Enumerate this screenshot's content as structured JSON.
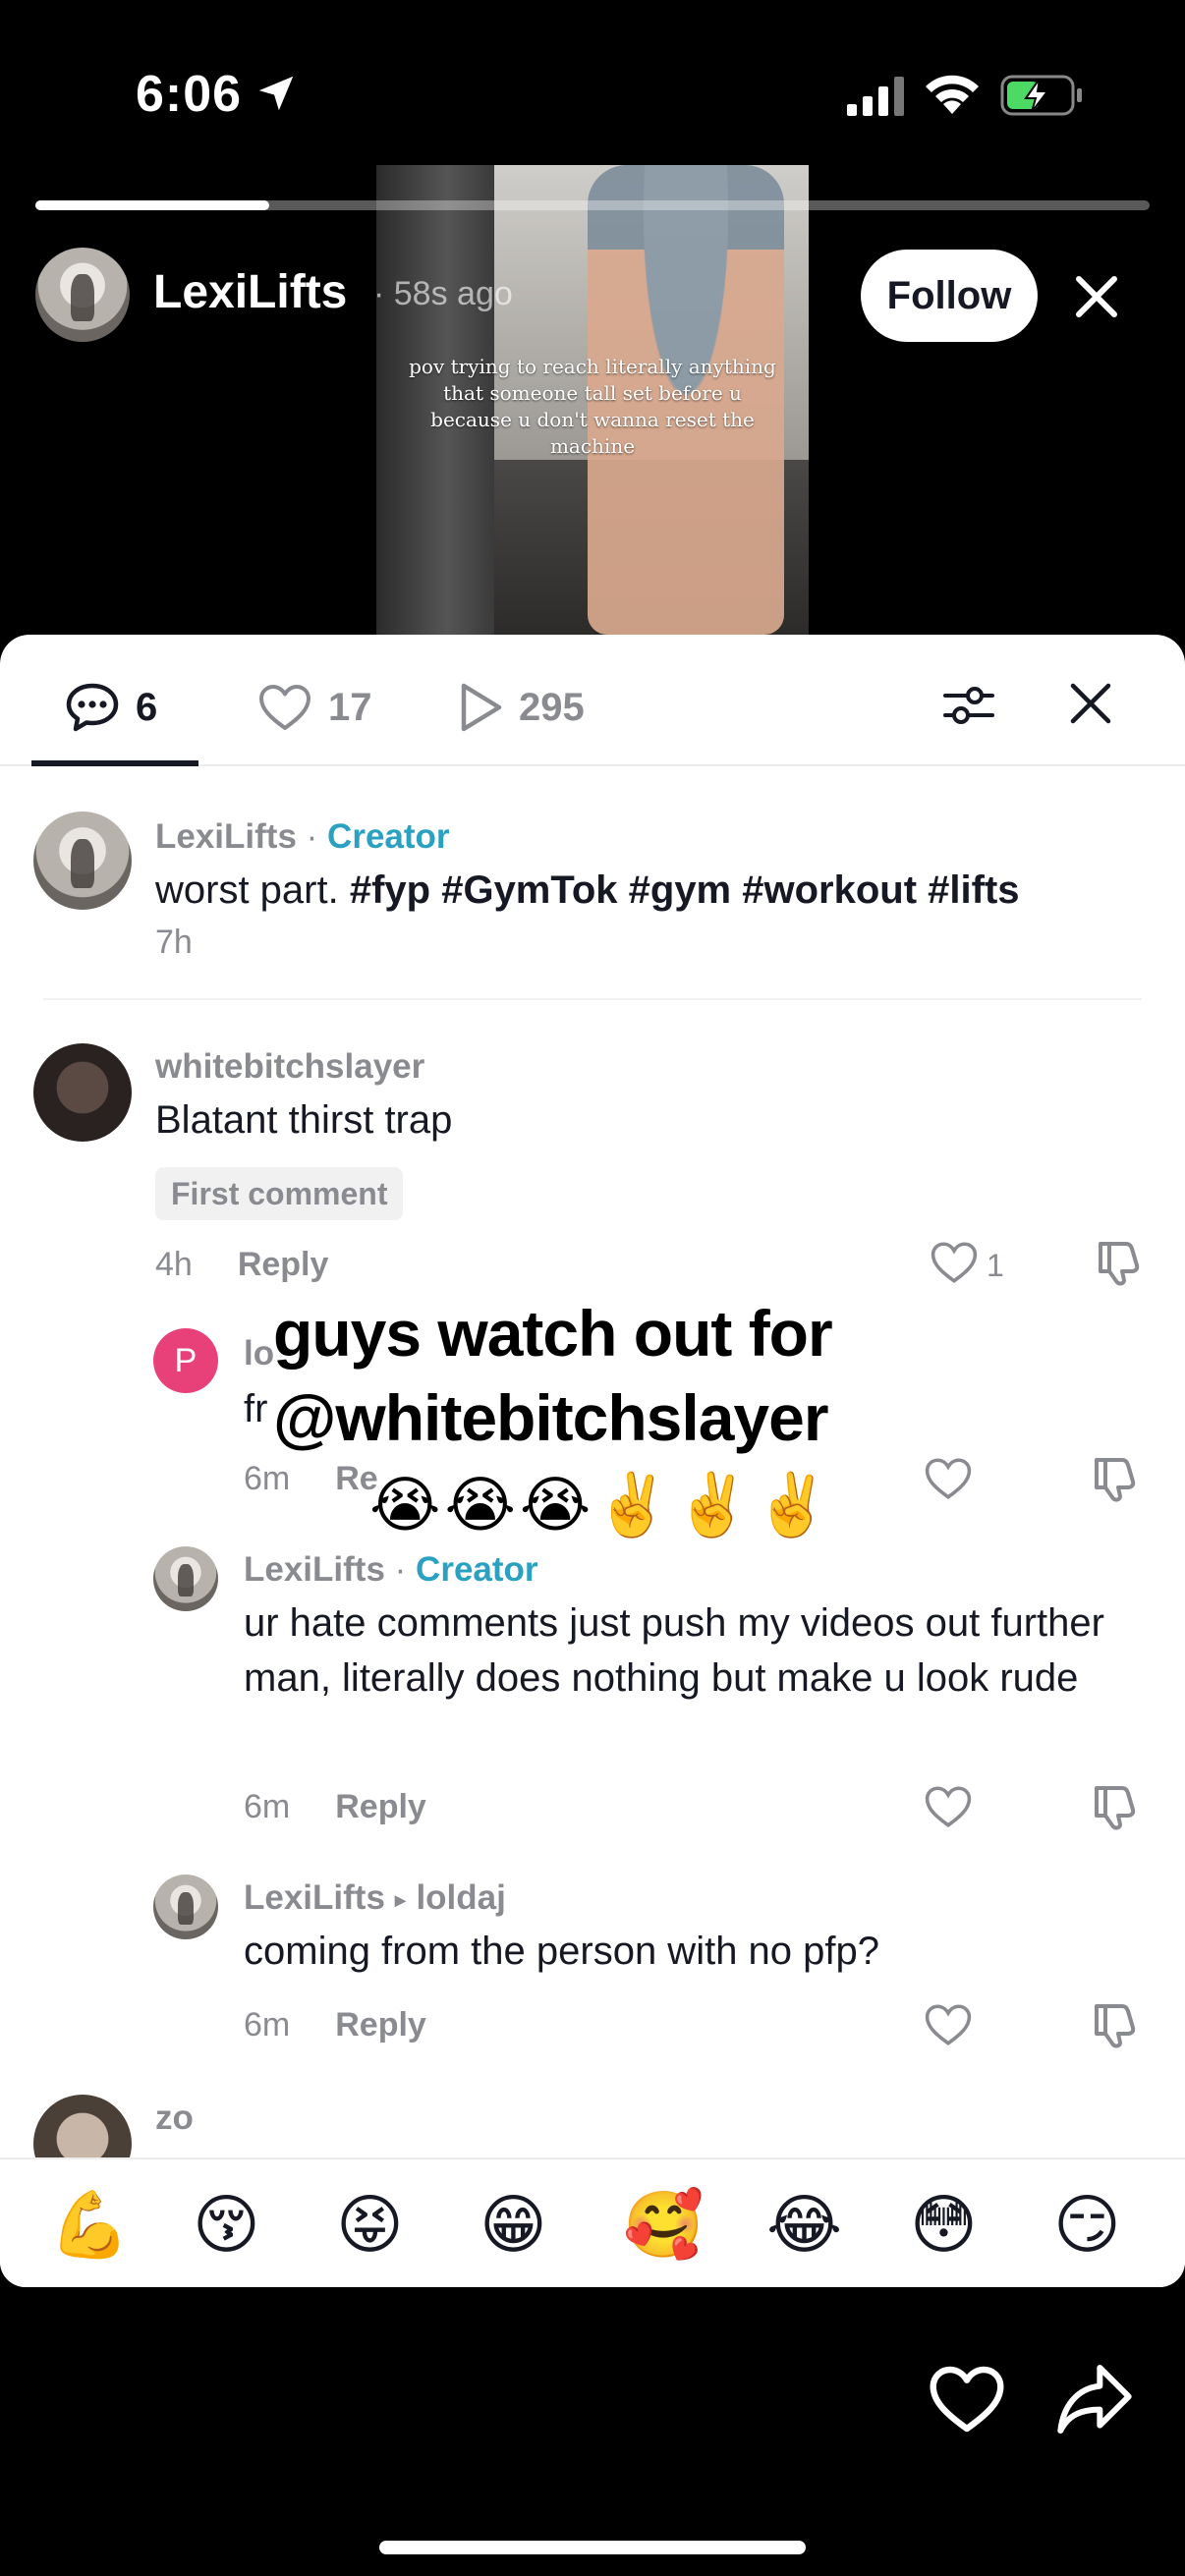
{
  "status_bar": {
    "time": "6:06",
    "icons": [
      "location-arrow-icon",
      "cellular-signal-icon",
      "wifi-icon",
      "battery-charging-icon"
    ]
  },
  "video": {
    "caption": "pov trying to reach literally anything that someone tall set before u because u don't wanna reset the machine",
    "progress_fraction": 0.21
  },
  "author": {
    "name": "LexiLifts",
    "posted_ago": "· 58s ago",
    "follow_label": "Follow"
  },
  "tabs": [
    {
      "icon": "comment-icon",
      "count": "6"
    },
    {
      "icon": "heart-outline-icon",
      "count": "17"
    },
    {
      "icon": "play-icon",
      "count": "295"
    }
  ],
  "comments": {
    "creator_post": {
      "username": "LexiLifts",
      "separator": "·",
      "creator_label": "Creator",
      "text_plain": "worst part. ",
      "text_tags": "#fyp #GymTok #gym #workout #lifts",
      "time": "7h"
    },
    "c1": {
      "username": "whitebitchslayer",
      "text": "Blatant thirst trap",
      "badge": "First comment",
      "time": "4h",
      "reply_label": "Reply",
      "likes": "1"
    },
    "r1": {
      "avatar_letter": "P",
      "username_partial": "lo",
      "text_partial": "fr",
      "time": "6m",
      "reply_label": "Re"
    },
    "r2": {
      "username": "LexiLifts",
      "separator": "·",
      "creator_label": "Creator",
      "text": "ur hate comments just push my videos out further man, literally does nothing but make u look rude",
      "time": "6m",
      "reply_label": "Reply"
    },
    "r3": {
      "username": "LexiLifts",
      "arrow": "▸",
      "reply_to": "loldaj",
      "text": "coming from the person with no pfp?",
      "time": "6m",
      "reply_label": "Reply"
    },
    "c2": {
      "username": "zo"
    }
  },
  "sticker": {
    "line1": "guys watch out for",
    "line2": "@whitebitchslayer",
    "emojis": "😭😭😭✌️✌️✌️"
  },
  "emoji_bar": [
    "💪",
    "😚",
    "😝",
    "😁",
    "🥰",
    "😂",
    "😳",
    "😏"
  ],
  "colors": {
    "creator_accent": "#2aa1c0",
    "muted_text": "#8a8b91",
    "avatar_p": "#e8417a"
  }
}
